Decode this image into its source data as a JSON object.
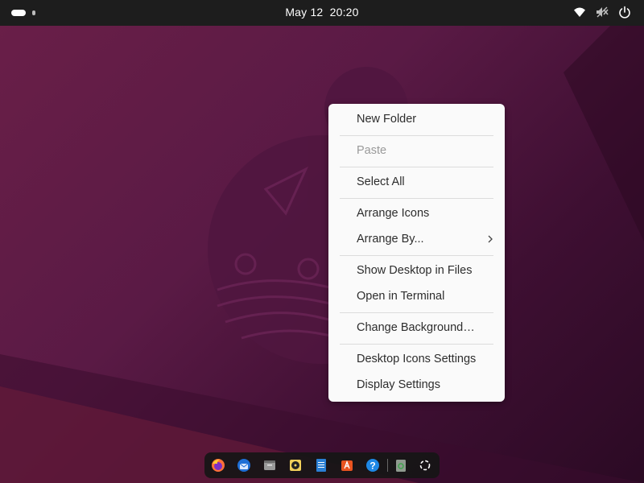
{
  "topbar": {
    "clock_date": "May 12",
    "clock_time": "20:20",
    "icons": [
      "activities-icon",
      "wifi-icon",
      "volume-muted-icon",
      "power-icon"
    ]
  },
  "context_menu": {
    "items": [
      {
        "label": "New Folder",
        "enabled": true
      },
      {
        "label": "Paste",
        "enabled": false
      },
      {
        "label": "Select All",
        "enabled": true
      },
      {
        "label": "Arrange Icons",
        "enabled": true
      },
      {
        "label": "Arrange By...",
        "enabled": true,
        "submenu": true
      },
      {
        "label": "Show Desktop in Files",
        "enabled": true
      },
      {
        "label": "Open in Terminal",
        "enabled": true
      },
      {
        "label": "Change Background…",
        "enabled": true
      },
      {
        "label": "Desktop Icons Settings",
        "enabled": true
      },
      {
        "label": "Display Settings",
        "enabled": true
      }
    ]
  },
  "dock": {
    "apps": [
      "firefox-icon",
      "thunderbird-icon",
      "files-icon",
      "rhythmbox-icon",
      "writer-icon",
      "software-center-icon",
      "help-icon",
      "trash-icon",
      "show-apps-icon"
    ]
  },
  "colors": {
    "topbar": "#1d1d1d",
    "menu_bg": "#fafafa",
    "wallpaper_base": "#5a1a45",
    "accent_orange": "#e95420"
  }
}
